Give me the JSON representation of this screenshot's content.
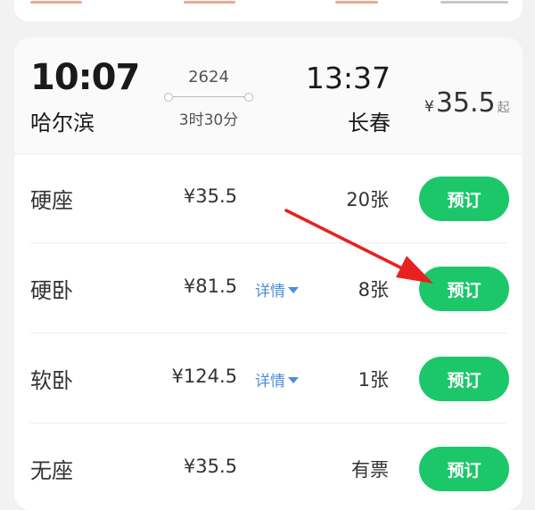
{
  "previous_card": {
    "fragments": [
      {
        "color": "#f0a890"
      },
      {
        "color": "#f0a890"
      },
      {
        "color": "#f0a890"
      },
      {
        "color": "#c8c8c8"
      }
    ]
  },
  "train": {
    "departure_time": "10:07",
    "departure_station": "哈尔滨",
    "number": "2624",
    "duration": "3时30分",
    "arrival_time": "13:37",
    "arrival_station": "长春",
    "lowest_price": {
      "currency": "¥",
      "value": "35.5",
      "suffix": "起"
    }
  },
  "seats": [
    {
      "name": "硬座",
      "price": "¥35.5",
      "detail": "",
      "count": "20张",
      "book_label": "预订"
    },
    {
      "name": "硬卧",
      "price": "¥81.5",
      "detail": "详情",
      "count": "8张",
      "book_label": "预订"
    },
    {
      "name": "软卧",
      "price": "¥124.5",
      "detail": "详情",
      "count": "1张",
      "book_label": "预订"
    },
    {
      "name": "无座",
      "price": "¥35.5",
      "detail": "",
      "count": "有票",
      "book_label": "预订"
    }
  ],
  "colors": {
    "book_button": "#1cc76a",
    "detail_link": "#4a8fdb",
    "annotation_arrow": "#e8201e"
  },
  "icons": {
    "detail_caret": "caret-down-icon",
    "annotation": "red-arrow-icon"
  }
}
